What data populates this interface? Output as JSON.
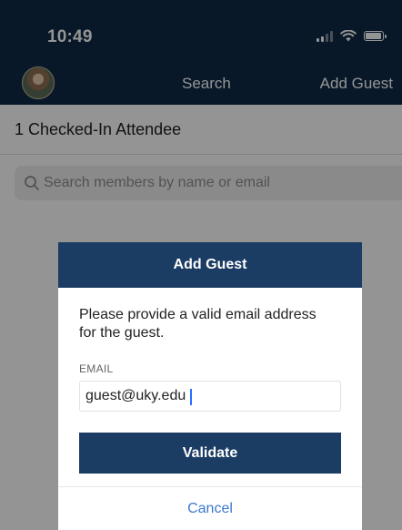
{
  "status_bar": {
    "time": "10:49",
    "icons": [
      "signal-icon",
      "wifi-icon",
      "battery-icon"
    ]
  },
  "nav": {
    "title": "Search",
    "right_action": "Add Guest"
  },
  "attendees": {
    "header": "1 Checked-In Attendee"
  },
  "search": {
    "placeholder": "Search members by name or email"
  },
  "modal": {
    "title": "Add Guest",
    "message": "Please provide a valid email address for the guest.",
    "email_label": "EMAIL",
    "email_value": "guest@uky.edu",
    "validate_label": "Validate",
    "cancel_label": "Cancel"
  },
  "colors": {
    "navy": "#0e2a47",
    "modal_header": "#1b3c63",
    "link_blue": "#3b7ad0"
  }
}
